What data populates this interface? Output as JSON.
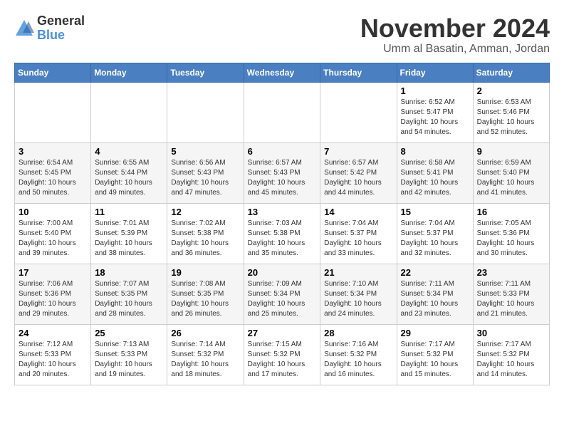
{
  "header": {
    "logo_general": "General",
    "logo_blue": "Blue",
    "month_title": "November 2024",
    "location": "Umm al Basatin, Amman, Jordan"
  },
  "weekdays": [
    "Sunday",
    "Monday",
    "Tuesday",
    "Wednesday",
    "Thursday",
    "Friday",
    "Saturday"
  ],
  "weeks": [
    {
      "days": [
        {
          "num": "",
          "info": ""
        },
        {
          "num": "",
          "info": ""
        },
        {
          "num": "",
          "info": ""
        },
        {
          "num": "",
          "info": ""
        },
        {
          "num": "",
          "info": ""
        },
        {
          "num": "1",
          "info": "Sunrise: 6:52 AM\nSunset: 5:47 PM\nDaylight: 10 hours\nand 54 minutes."
        },
        {
          "num": "2",
          "info": "Sunrise: 6:53 AM\nSunset: 5:46 PM\nDaylight: 10 hours\nand 52 minutes."
        }
      ]
    },
    {
      "days": [
        {
          "num": "3",
          "info": "Sunrise: 6:54 AM\nSunset: 5:45 PM\nDaylight: 10 hours\nand 50 minutes."
        },
        {
          "num": "4",
          "info": "Sunrise: 6:55 AM\nSunset: 5:44 PM\nDaylight: 10 hours\nand 49 minutes."
        },
        {
          "num": "5",
          "info": "Sunrise: 6:56 AM\nSunset: 5:43 PM\nDaylight: 10 hours\nand 47 minutes."
        },
        {
          "num": "6",
          "info": "Sunrise: 6:57 AM\nSunset: 5:43 PM\nDaylight: 10 hours\nand 45 minutes."
        },
        {
          "num": "7",
          "info": "Sunrise: 6:57 AM\nSunset: 5:42 PM\nDaylight: 10 hours\nand 44 minutes."
        },
        {
          "num": "8",
          "info": "Sunrise: 6:58 AM\nSunset: 5:41 PM\nDaylight: 10 hours\nand 42 minutes."
        },
        {
          "num": "9",
          "info": "Sunrise: 6:59 AM\nSunset: 5:40 PM\nDaylight: 10 hours\nand 41 minutes."
        }
      ]
    },
    {
      "days": [
        {
          "num": "10",
          "info": "Sunrise: 7:00 AM\nSunset: 5:40 PM\nDaylight: 10 hours\nand 39 minutes."
        },
        {
          "num": "11",
          "info": "Sunrise: 7:01 AM\nSunset: 5:39 PM\nDaylight: 10 hours\nand 38 minutes."
        },
        {
          "num": "12",
          "info": "Sunrise: 7:02 AM\nSunset: 5:38 PM\nDaylight: 10 hours\nand 36 minutes."
        },
        {
          "num": "13",
          "info": "Sunrise: 7:03 AM\nSunset: 5:38 PM\nDaylight: 10 hours\nand 35 minutes."
        },
        {
          "num": "14",
          "info": "Sunrise: 7:04 AM\nSunset: 5:37 PM\nDaylight: 10 hours\nand 33 minutes."
        },
        {
          "num": "15",
          "info": "Sunrise: 7:04 AM\nSunset: 5:37 PM\nDaylight: 10 hours\nand 32 minutes."
        },
        {
          "num": "16",
          "info": "Sunrise: 7:05 AM\nSunset: 5:36 PM\nDaylight: 10 hours\nand 30 minutes."
        }
      ]
    },
    {
      "days": [
        {
          "num": "17",
          "info": "Sunrise: 7:06 AM\nSunset: 5:36 PM\nDaylight: 10 hours\nand 29 minutes."
        },
        {
          "num": "18",
          "info": "Sunrise: 7:07 AM\nSunset: 5:35 PM\nDaylight: 10 hours\nand 28 minutes."
        },
        {
          "num": "19",
          "info": "Sunrise: 7:08 AM\nSunset: 5:35 PM\nDaylight: 10 hours\nand 26 minutes."
        },
        {
          "num": "20",
          "info": "Sunrise: 7:09 AM\nSunset: 5:34 PM\nDaylight: 10 hours\nand 25 minutes."
        },
        {
          "num": "21",
          "info": "Sunrise: 7:10 AM\nSunset: 5:34 PM\nDaylight: 10 hours\nand 24 minutes."
        },
        {
          "num": "22",
          "info": "Sunrise: 7:11 AM\nSunset: 5:34 PM\nDaylight: 10 hours\nand 23 minutes."
        },
        {
          "num": "23",
          "info": "Sunrise: 7:11 AM\nSunset: 5:33 PM\nDaylight: 10 hours\nand 21 minutes."
        }
      ]
    },
    {
      "days": [
        {
          "num": "24",
          "info": "Sunrise: 7:12 AM\nSunset: 5:33 PM\nDaylight: 10 hours\nand 20 minutes."
        },
        {
          "num": "25",
          "info": "Sunrise: 7:13 AM\nSunset: 5:33 PM\nDaylight: 10 hours\nand 19 minutes."
        },
        {
          "num": "26",
          "info": "Sunrise: 7:14 AM\nSunset: 5:32 PM\nDaylight: 10 hours\nand 18 minutes."
        },
        {
          "num": "27",
          "info": "Sunrise: 7:15 AM\nSunset: 5:32 PM\nDaylight: 10 hours\nand 17 minutes."
        },
        {
          "num": "28",
          "info": "Sunrise: 7:16 AM\nSunset: 5:32 PM\nDaylight: 10 hours\nand 16 minutes."
        },
        {
          "num": "29",
          "info": "Sunrise: 7:17 AM\nSunset: 5:32 PM\nDaylight: 10 hours\nand 15 minutes."
        },
        {
          "num": "30",
          "info": "Sunrise: 7:17 AM\nSunset: 5:32 PM\nDaylight: 10 hours\nand 14 minutes."
        }
      ]
    }
  ]
}
